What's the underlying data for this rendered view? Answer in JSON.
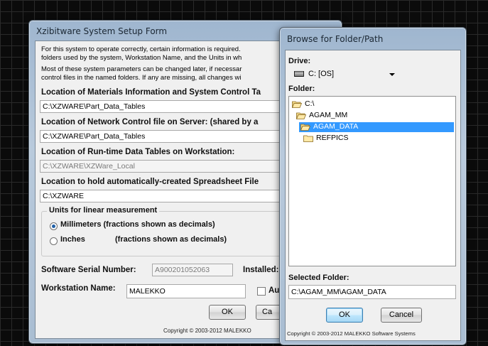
{
  "setup_form": {
    "title": "Xzibitware System Setup Form",
    "intro_1": "For this system to operate correctly, certain information is required.",
    "intro_2": "folders used by the system, Workstation Name, and the Units in wh",
    "intro_3": "Most of these system parameters can be changed later, if necessar",
    "intro_4": "control files in the named folders.  If any are missing, all changes wi",
    "materials_label": "Location of Materials Information and System Control Ta",
    "materials_value": "C:\\XZWARE\\Part_Data_Tables",
    "network_label": "Location of Network Control file on Server: (shared by a",
    "network_value": "C:\\XZWARE\\Part_Data_Tables",
    "runtime_label": "Location of Run-time Data Tables on Workstation:",
    "runtime_value": "C:\\XZWARE\\XZWare_Local",
    "spreadsheet_label": "Location to hold automatically-created Spreadsheet File",
    "spreadsheet_value": "C:\\XZWARE",
    "units_group": "Units for linear measurement",
    "units_mm": "Millimeters (fractions shown as decimals)",
    "units_in_a": "Inches",
    "units_in_b": "(fractions shown as decimals)",
    "units_selected": "mm",
    "serial_label": "Software Serial Number:",
    "serial_value": "A900201052063",
    "installed_label": "Installed:",
    "workstation_label": "Workstation Name:",
    "workstation_value": "MALEKKO",
    "auto_label": "Au",
    "ok_label": "OK",
    "cancel_label": "Ca",
    "copyright": "Copyright © 2003-2012  MALEKKO"
  },
  "browse_dialog": {
    "title": "Browse for Folder/Path",
    "drive_label": "Drive:",
    "drive_value": "C: [OS]",
    "folder_label": "Folder:",
    "tree": [
      {
        "label": "C:\\",
        "icon": "open-folder-icon",
        "selected": false
      },
      {
        "label": "AGAM_MM",
        "icon": "open-folder-icon",
        "selected": false
      },
      {
        "label": "AGAM_DATA",
        "icon": "open-folder-icon",
        "selected": true
      },
      {
        "label": "REFPICS",
        "icon": "folder-icon",
        "selected": false
      }
    ],
    "selected_folder_label": "Selected Folder:",
    "selected_folder_value": "C:\\AGAM_MM\\AGAM_DATA",
    "ok_label": "OK",
    "cancel_label": "Cancel",
    "copyright": "Copyright © 2003-2012  MALEKKO Software Systems"
  },
  "colors": {
    "selection": "#3399ff",
    "window_frame": "#a9bdd2"
  }
}
